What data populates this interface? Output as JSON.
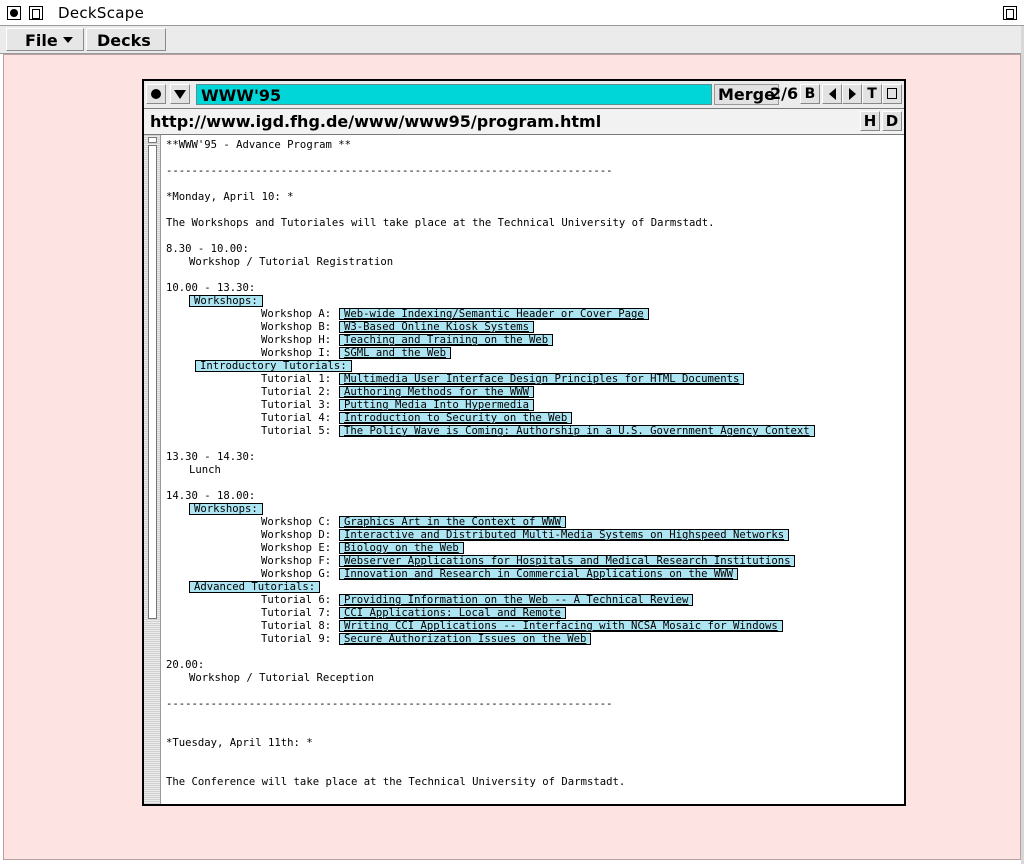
{
  "app": {
    "title": "DeckScape"
  },
  "menubar": {
    "file": "File",
    "decks": "Decks"
  },
  "deck": {
    "title": "WWW'95",
    "merge": "Merge",
    "page_count": "2/6",
    "btn_b": "B",
    "btn_t": "T",
    "url": "http://www.igd.fhg.de/www/www95/program.html",
    "btn_h": "H",
    "btn_d": "D"
  },
  "doc": {
    "heading": "**WWW'95 - Advance Program **",
    "rule": "----------------------------------------------------------------------",
    "monday": "*Monday, April 10: *",
    "monday_intro": "The Workshops and Tutoriales will take place at the Technical University of Darmstadt.",
    "t1": "8.30 - 10.00:",
    "t1_desc": "Workshop / Tutorial Registration",
    "t2": "10.00 - 13.30:",
    "workshops_label": "Workshops:",
    "intro_tutorials_label": "Introductory Tutorials:",
    "am_workshops": [
      {
        "label": "Workshop A:",
        "title": "Web-wide Indexing/Semantic Header or Cover Page"
      },
      {
        "label": "Workshop B:",
        "title": "W3-Based Online Kiosk Systems"
      },
      {
        "label": "Workshop H:",
        "title": "Teaching and Training on the Web"
      },
      {
        "label": "Workshop I:",
        "title": "SGML and the Web"
      }
    ],
    "am_tutorials": [
      {
        "label": "Tutorial 1:",
        "title": "Multimedia User Interface Design Principles for HTML Documents"
      },
      {
        "label": "Tutorial 2:",
        "title": "Authoring Methods for the WWW"
      },
      {
        "label": "Tutorial 3:",
        "title": "Putting Media Into Hypermedia"
      },
      {
        "label": "Tutorial 4:",
        "title": "Introduction to Security on the Web"
      },
      {
        "label": "Tutorial 5:",
        "title": "The Policy Wave is Coming: Authorship in a U.S. Government Agency Context"
      }
    ],
    "t3": "13.30 - 14.30:",
    "t3_desc": "Lunch",
    "t4": "14.30 - 18.00:",
    "workshops_label_2": "Workshops:",
    "adv_tutorials_label": "Advanced Tutorials:",
    "pm_workshops": [
      {
        "label": "Workshop C:",
        "title": "Graphics Art in the Context of WWW"
      },
      {
        "label": "Workshop D:",
        "title": "Interactive and Distributed Multi-Media Systems on Highspeed Networks"
      },
      {
        "label": "Workshop E:",
        "title": "Biology on the Web"
      },
      {
        "label": "Workshop F:",
        "title": "Webserver Applications for Hospitals and Medical Research Institutions"
      },
      {
        "label": "Workshop G:",
        "title": "Innovation and Research in Commercial Applications on the WWW"
      }
    ],
    "pm_tutorials": [
      {
        "label": "Tutorial 6:",
        "title": "Providing Information on the Web -- A Technical Review"
      },
      {
        "label": "Tutorial 7:",
        "title": "CCI Applications: Local and Remote"
      },
      {
        "label": "Tutorial 8:",
        "title": "Writing CCI Applications -- Interfacing with NCSA Mosaic for Windows"
      },
      {
        "label": "Tutorial 9:",
        "title": "Secure Authorization Issues on the Web"
      }
    ],
    "t5": "20.00:",
    "t5_desc": "Workshop / Tutorial Reception",
    "tuesday": "*Tuesday, April 11th: *",
    "tuesday_intro": "The Conference will take place at the Technical University of Darmstadt."
  },
  "colors": {
    "desktop": "#fee3e3",
    "deck_title": "#00d5d8",
    "link_bg": "#aee5f3"
  },
  "icons": [
    "close-icon",
    "window-menu-icon",
    "maximize-icon",
    "dropdown-arrow-icon",
    "back-arrow-icon",
    "forward-arrow-icon",
    "detach-icon"
  ]
}
